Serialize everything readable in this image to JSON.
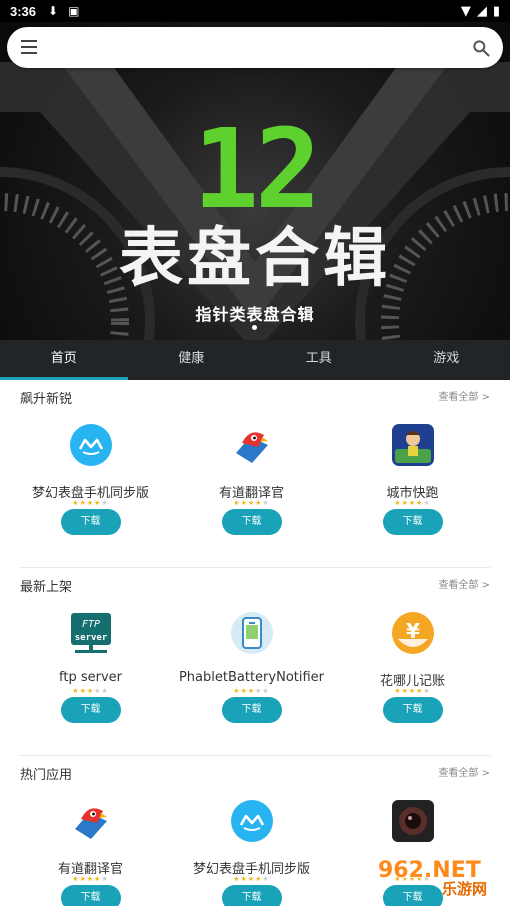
{
  "status_bar": {
    "time": "3:36"
  },
  "search": {
    "placeholder": ""
  },
  "banner": {
    "number": "12",
    "title": "表盘合辑",
    "subtitle": "指针类表盘合辑"
  },
  "tabs": [
    {
      "label": "首页"
    },
    {
      "label": "健康"
    },
    {
      "label": "工具"
    },
    {
      "label": "游戏"
    }
  ],
  "sections": [
    {
      "title": "飙升新锐",
      "more": "查看全部 >",
      "apps": [
        {
          "name": "梦幻表盘手机同步版",
          "icon": "watch-sync-icon",
          "rating": 4,
          "button": "下载"
        },
        {
          "name": "有道翻译官",
          "icon": "parrot-icon",
          "rating": 4,
          "button": "下载"
        },
        {
          "name": "城市快跑",
          "icon": "runner-game-icon",
          "rating": 4,
          "button": "下载"
        }
      ]
    },
    {
      "title": "最新上架",
      "more": "查看全部 >",
      "apps": [
        {
          "name": "ftp server",
          "icon": "ftp-server-icon",
          "rating": 3,
          "button": "下载"
        },
        {
          "name": "PhabletBatteryNotifier",
          "icon": "battery-phone-icon",
          "rating": 3,
          "button": "下载"
        },
        {
          "name": "花哪儿记账",
          "icon": "yuan-coin-icon",
          "rating": 4,
          "button": "下载"
        }
      ]
    },
    {
      "title": "热门应用",
      "more": "查看全部 >",
      "apps": [
        {
          "name": "有道翻译官",
          "icon": "parrot-icon",
          "rating": 4,
          "button": "下载"
        },
        {
          "name": "梦幻表盘手机同步版",
          "icon": "watch-sync-icon",
          "rating": 4,
          "button": "下载"
        },
        {
          "name": "",
          "icon": "camera-lens-icon",
          "rating": 4,
          "button": "下载"
        }
      ]
    }
  ],
  "watermark": {
    "line1": "962.NET",
    "line2": "乐游网"
  },
  "colors": {
    "accent": "#1aa3b8",
    "banner_number": "#5fd12e",
    "tab_bar": "#222528"
  }
}
